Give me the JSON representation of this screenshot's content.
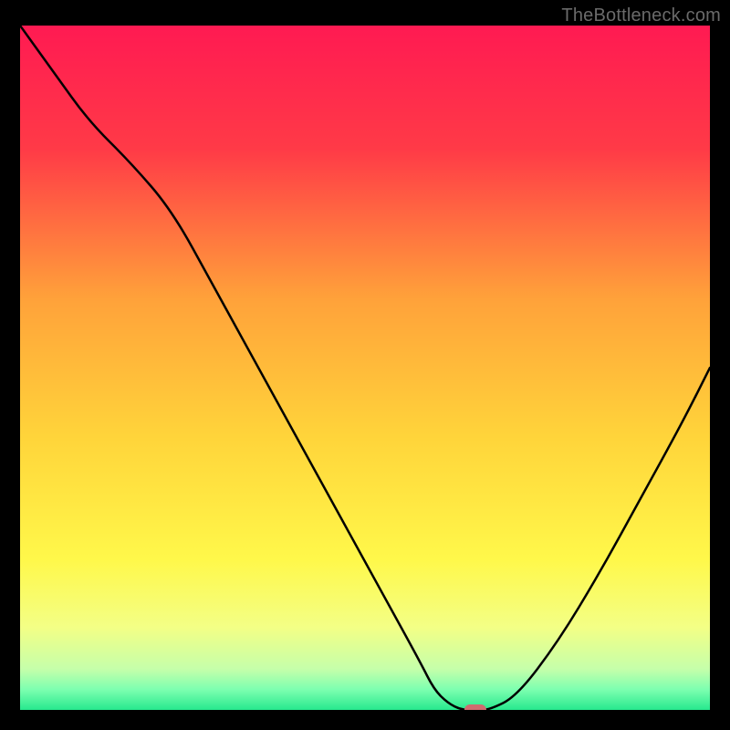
{
  "watermark": "TheBottleneck.com",
  "chart_data": {
    "type": "line",
    "title": "",
    "xlabel": "",
    "ylabel": "",
    "xlim": [
      0,
      100
    ],
    "ylim": [
      0,
      100
    ],
    "grid": false,
    "series": [
      {
        "name": "curve",
        "x": [
          0,
          5,
          10,
          16,
          22,
          28,
          34,
          40,
          46,
          52,
          58,
          60,
          62,
          64,
          66,
          68,
          72,
          78,
          84,
          90,
          96,
          100
        ],
        "y": [
          100,
          93,
          86,
          80,
          73,
          62,
          51,
          40,
          29,
          18,
          7,
          3,
          1,
          0,
          0,
          0,
          2,
          10,
          20,
          31,
          42,
          50
        ]
      }
    ],
    "marker": {
      "x": 66,
      "y": 0,
      "color": "#cf6b6f"
    },
    "background_gradient": {
      "type": "vertical",
      "stops": [
        {
          "pos": 0.0,
          "color": "#ff1a52"
        },
        {
          "pos": 0.18,
          "color": "#ff3a47"
        },
        {
          "pos": 0.4,
          "color": "#ffa23a"
        },
        {
          "pos": 0.6,
          "color": "#ffd43a"
        },
        {
          "pos": 0.78,
          "color": "#fff84a"
        },
        {
          "pos": 0.88,
          "color": "#f3ff86"
        },
        {
          "pos": 0.94,
          "color": "#c6ffaa"
        },
        {
          "pos": 0.97,
          "color": "#7dffb0"
        },
        {
          "pos": 1.0,
          "color": "#27e98e"
        }
      ]
    }
  }
}
